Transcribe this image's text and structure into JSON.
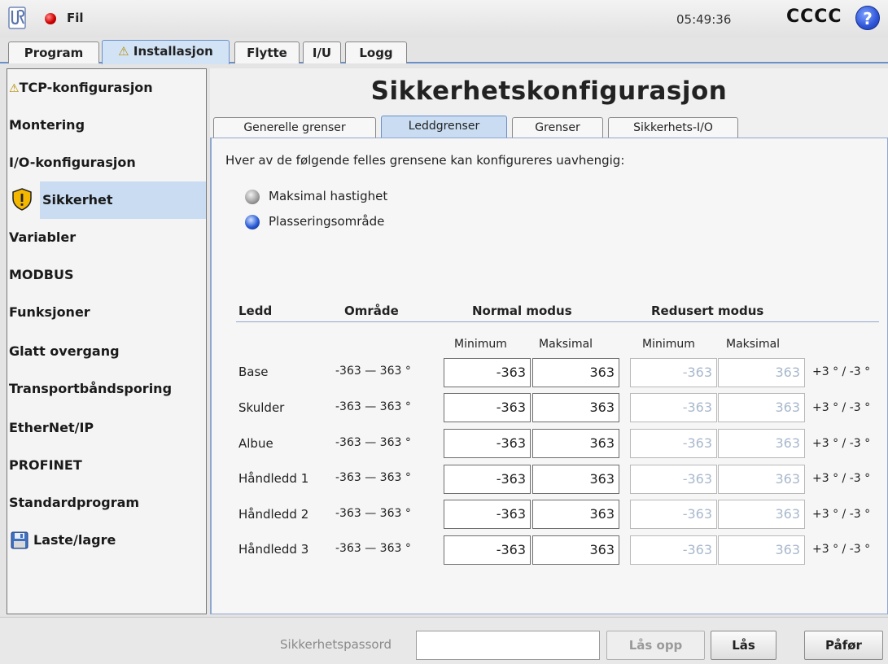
{
  "topbar": {
    "file_menu": "Fil",
    "clock": "05:49:36",
    "robot_name": "CCCC",
    "help_glyph": "?"
  },
  "main_tabs": [
    {
      "label": "Program"
    },
    {
      "label": "Installasjon",
      "warning": "⚠",
      "active": true
    },
    {
      "label": "Flytte"
    },
    {
      "label": "I/U"
    },
    {
      "label": "Logg"
    }
  ],
  "sidebar": {
    "items": [
      {
        "label": "TCP-konfigurasjon",
        "prefix": "⚠"
      },
      {
        "label": "Montering"
      },
      {
        "label": "I/O-konfigurasjon"
      },
      {
        "label": "Sikkerhet",
        "selected": true,
        "icon": "shield-warning-icon"
      },
      {
        "label": "Variabler"
      },
      {
        "label": "MODBUS"
      },
      {
        "label": "Funksjoner"
      },
      {
        "label": "Glatt overgang"
      },
      {
        "label": "Transportbåndsporing"
      },
      {
        "label": "EtherNet/IP"
      },
      {
        "label": "PROFINET"
      },
      {
        "label": "Standardprogram"
      },
      {
        "label": "Laste/lagre",
        "icon": "floppy-disk-icon"
      }
    ]
  },
  "page_title": "Sikkerhetskonfigurasjon",
  "sub_tabs": [
    {
      "label": "Generelle grenser"
    },
    {
      "label": "Leddgrenser",
      "active": true
    },
    {
      "label": "Grenser"
    },
    {
      "label": "Sikkerhets-I/O"
    }
  ],
  "intro": "Hver av de følgende felles grensene kan konfigureres uavhengig:",
  "options": [
    {
      "label": "Maksimal hastighet",
      "selected": false
    },
    {
      "label": "Plasseringsområde",
      "selected": true
    }
  ],
  "table": {
    "headers": {
      "joint": "Ledd",
      "range": "Område",
      "normal": "Normal modus",
      "reduced": "Redusert modus"
    },
    "subheaders": {
      "min": "Minimum",
      "max": "Maksimal"
    },
    "rows": [
      {
        "joint": "Base",
        "range": "-363 — 363 °",
        "normal_min": "-363",
        "normal_max": "363",
        "reduced_min": "-363",
        "reduced_max": "363",
        "tolerance": "+3 ° / -3 °"
      },
      {
        "joint": "Skulder",
        "range": "-363 — 363 °",
        "normal_min": "-363",
        "normal_max": "363",
        "reduced_min": "-363",
        "reduced_max": "363",
        "tolerance": "+3 ° / -3 °"
      },
      {
        "joint": "Albue",
        "range": "-363 — 363 °",
        "normal_min": "-363",
        "normal_max": "363",
        "reduced_min": "-363",
        "reduced_max": "363",
        "tolerance": "+3 ° / -3 °"
      },
      {
        "joint": "Håndledd 1",
        "range": "-363 — 363 °",
        "normal_min": "-363",
        "normal_max": "363",
        "reduced_min": "-363",
        "reduced_max": "363",
        "tolerance": "+3 ° / -3 °"
      },
      {
        "joint": "Håndledd 2",
        "range": "-363 — 363 °",
        "normal_min": "-363",
        "normal_max": "363",
        "reduced_min": "-363",
        "reduced_max": "363",
        "tolerance": "+3 ° / -3 °"
      },
      {
        "joint": "Håndledd 3",
        "range": "-363 — 363 °",
        "normal_min": "-363",
        "normal_max": "363",
        "reduced_min": "-363",
        "reduced_max": "363",
        "tolerance": "+3 ° / -3 °"
      }
    ]
  },
  "bottom": {
    "password_label": "Sikkerhetspassord",
    "password_value": "",
    "unlock_label": "Lås opp",
    "lock_label": "Lås",
    "apply_label": "Påfør"
  },
  "colors": {
    "accent": "#6a8fc9",
    "selected_bg": "#c9dcf1",
    "status_led": "#d00000",
    "disabled_text": "#a8b8cc"
  }
}
